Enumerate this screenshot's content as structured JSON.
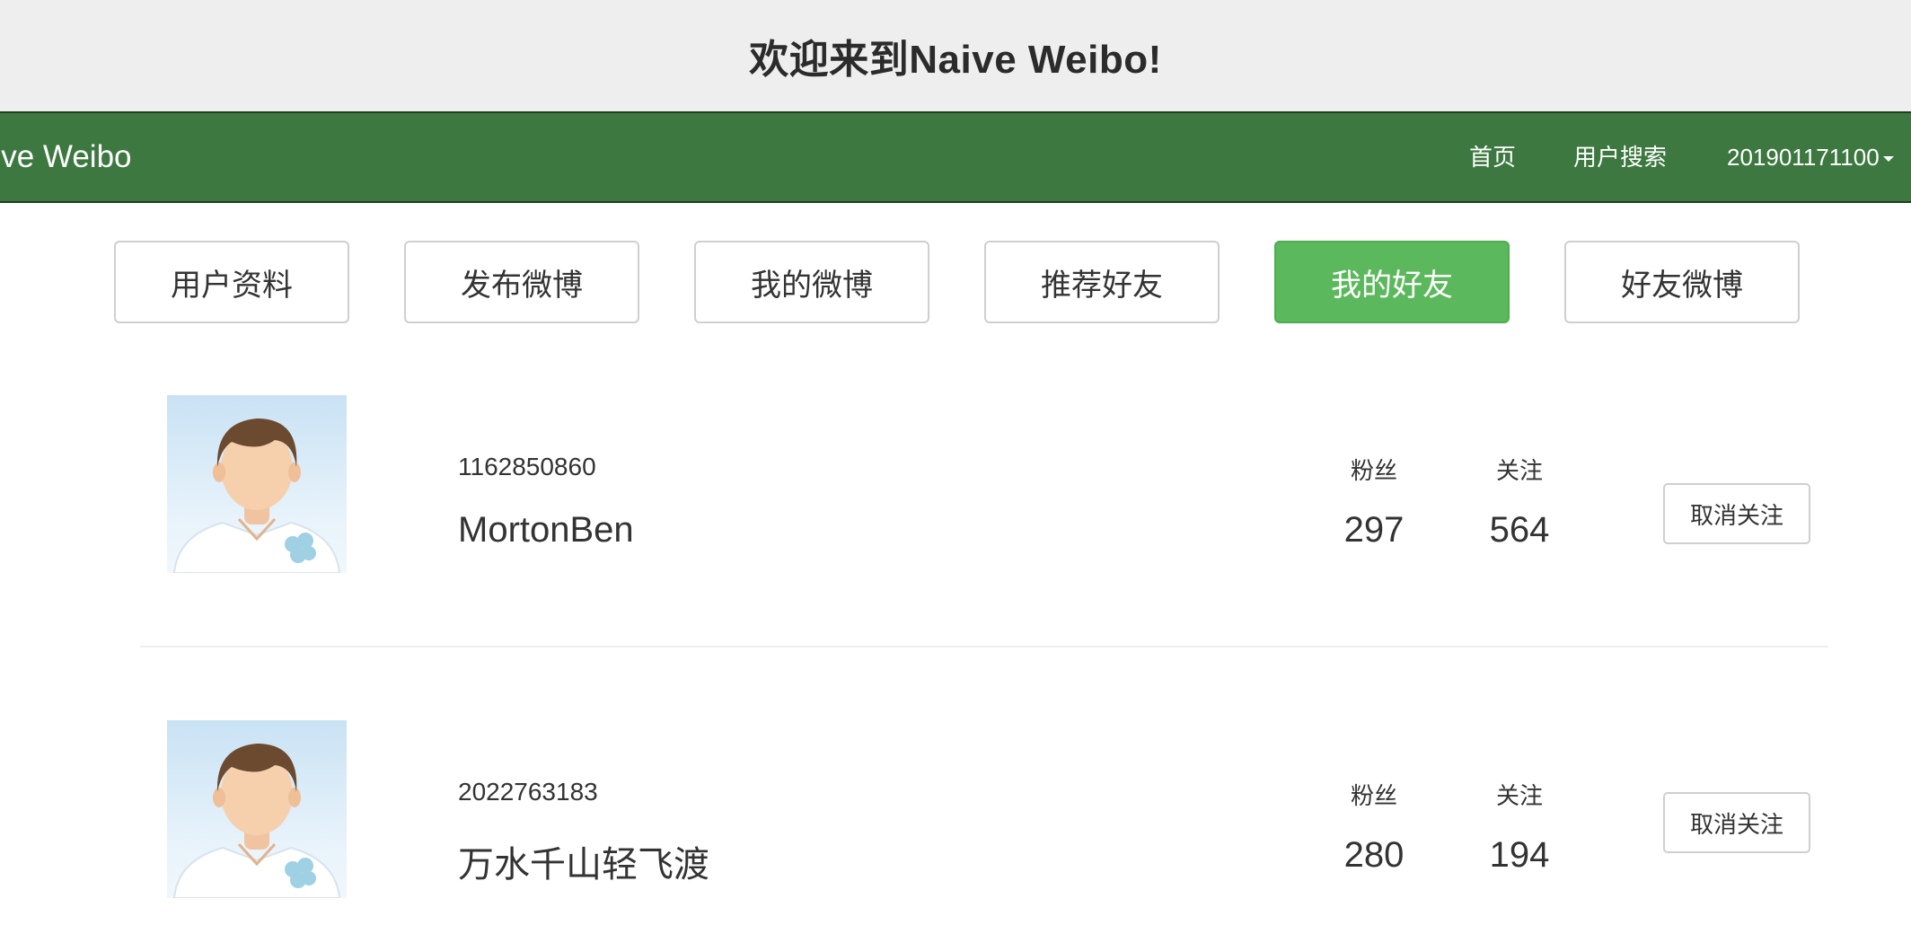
{
  "welcome": {
    "text": "欢迎来到Naive Weibo!"
  },
  "navbar": {
    "brand": "aive Weibo",
    "links": [
      "首页",
      "用户搜索"
    ],
    "user": "201901171100"
  },
  "tabs": [
    "用户资料",
    "发布微博",
    "我的微博",
    "推荐好友",
    "我的好友",
    "好友微博"
  ],
  "active_tab": "我的好友",
  "friends": [
    {
      "id": "1162850860",
      "name": "MortonBen",
      "followers_label": "粉丝",
      "following_label": "关注",
      "followers": "297",
      "following": "564",
      "action": "取消关注"
    },
    {
      "id": "2022763183",
      "name": "万水千山轻飞渡",
      "followers_label": "粉丝",
      "following_label": "关注",
      "followers": "280",
      "following": "194",
      "action": "取消关注"
    }
  ],
  "colors": {
    "navbar": "#3c783f",
    "active_tab": "#5cb85c",
    "banner": "#eeeeef"
  }
}
